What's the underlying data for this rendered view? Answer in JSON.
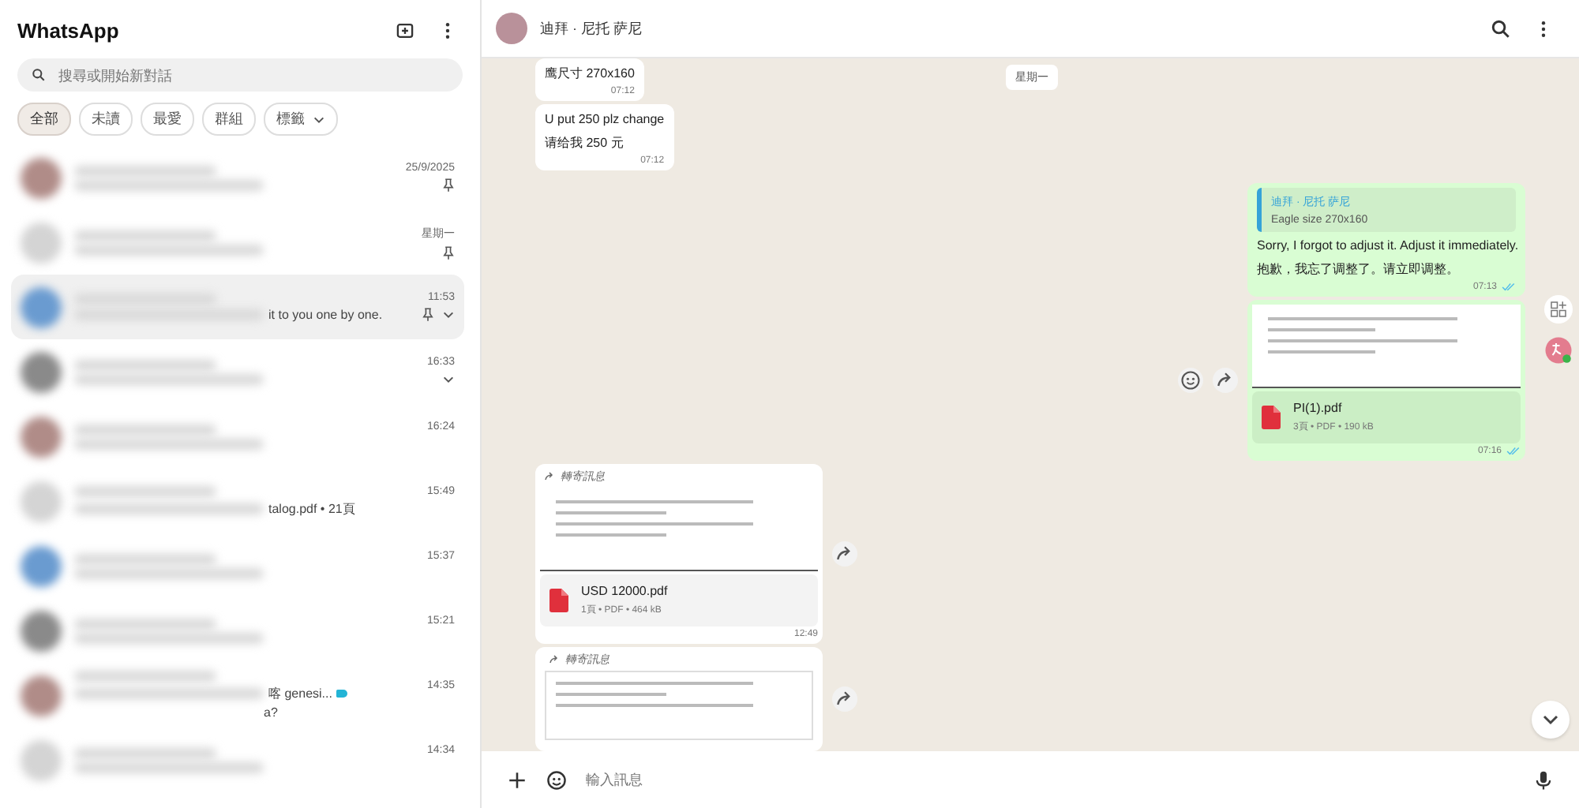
{
  "sidebar": {
    "title": "WhatsApp",
    "search": {
      "placeholder": "搜尋或開始新對話"
    },
    "filters": [
      {
        "label": "全部",
        "selected": true,
        "dropdown": false
      },
      {
        "label": "未讀",
        "selected": false,
        "dropdown": false
      },
      {
        "label": "最愛",
        "selected": false,
        "dropdown": false
      },
      {
        "label": "群組",
        "selected": false,
        "dropdown": false
      },
      {
        "label": "標籤",
        "selected": false,
        "dropdown": true
      }
    ],
    "chats": [
      {
        "time": "25/9/2025",
        "pinned": true,
        "menu": false,
        "selected": false,
        "label_tag": false
      },
      {
        "time": "星期一",
        "pinned": true,
        "menu": false,
        "selected": false,
        "label_tag": false
      },
      {
        "time": "11:53",
        "pinned": true,
        "menu": true,
        "selected": true,
        "preview": "it to you one by one.",
        "label_tag": false
      },
      {
        "time": "16:33",
        "pinned": false,
        "menu": true,
        "selected": false,
        "label_tag": false
      },
      {
        "time": "16:24",
        "pinned": false,
        "menu": false,
        "selected": false,
        "label_tag": false
      },
      {
        "time": "15:49",
        "pinned": false,
        "menu": false,
        "selected": false,
        "preview": "talog.pdf • 21頁",
        "label_tag": false
      },
      {
        "time": "15:37",
        "pinned": false,
        "menu": false,
        "selected": false,
        "label_tag": false
      },
      {
        "time": "15:21",
        "pinned": false,
        "menu": false,
        "selected": false,
        "label_tag": false
      },
      {
        "time": "14:35",
        "pinned": false,
        "menu": false,
        "selected": false,
        "preview": "喀 genesi...",
        "second": "a?",
        "label_tag": true
      },
      {
        "time": "14:34",
        "pinned": false,
        "menu": false,
        "selected": false,
        "label_tag": false
      }
    ]
  },
  "chat": {
    "title": "迪拜 · 尼托 萨尼",
    "day_chip": "星期一",
    "composer": {
      "placeholder": "輸入訊息"
    },
    "messages": [
      {
        "kind": "text",
        "outgoing": false,
        "lines": [
          "鹰尺寸 270x160"
        ],
        "time": "07:12"
      },
      {
        "kind": "text",
        "outgoing": false,
        "lines": [
          "U put 250 plz change",
          "请给我 250 元"
        ],
        "time": "07:12"
      },
      {
        "kind": "reply",
        "outgoing": true,
        "quote_author": "迪拜 · 尼托 萨尼",
        "quote_text": "Eagle size 270x160",
        "lines": [
          "Sorry, I forgot to adjust it. Adjust it immediately.",
          "抱歉，我忘了调整了。请立即调整。"
        ],
        "time": "07:13",
        "read": true
      },
      {
        "kind": "document",
        "outgoing": true,
        "file": "PI(1).pdf",
        "meta": "3頁 • PDF • 190 kB",
        "time": "07:16",
        "read": true
      },
      {
        "kind": "document",
        "outgoing": false,
        "forwarded": "轉寄訊息",
        "file": "USD 12000.pdf",
        "meta": "1頁 • PDF • 464 kB",
        "time": "12:49"
      },
      {
        "kind": "preview",
        "outgoing": false,
        "forwarded": "轉寄訊息"
      }
    ]
  }
}
